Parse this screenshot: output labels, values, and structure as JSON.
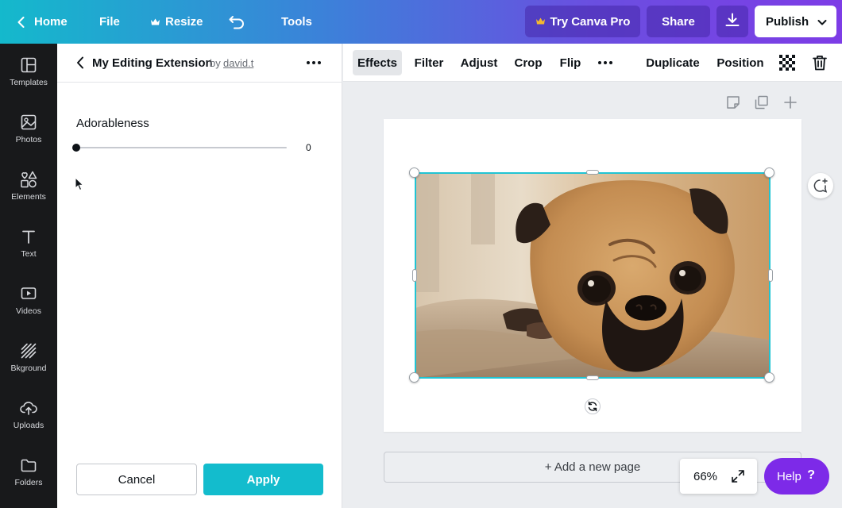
{
  "header": {
    "home_label": "Home",
    "file_label": "File",
    "resize_label": "Resize",
    "tools_label": "Tools",
    "try_pro_label": "Try Canva Pro",
    "share_label": "Share",
    "publish_label": "Publish"
  },
  "sidebar": {
    "items": [
      {
        "label": "Templates",
        "icon": "templates-icon"
      },
      {
        "label": "Photos",
        "icon": "photos-icon"
      },
      {
        "label": "Elements",
        "icon": "elements-icon"
      },
      {
        "label": "Text",
        "icon": "text-icon"
      },
      {
        "label": "Videos",
        "icon": "videos-icon"
      },
      {
        "label": "Bkground",
        "icon": "background-icon"
      },
      {
        "label": "Uploads",
        "icon": "uploads-icon"
      },
      {
        "label": "Folders",
        "icon": "folders-icon"
      }
    ]
  },
  "panel": {
    "title": "My Editing Extension",
    "by_label": "by",
    "author": "david.t",
    "slider": {
      "label": "Adorableness",
      "value": "0",
      "level": 0
    },
    "cancel_label": "Cancel",
    "apply_label": "Apply"
  },
  "toolbar": {
    "effects_label": "Effects",
    "filter_label": "Filter",
    "adjust_label": "Adjust",
    "crop_label": "Crop",
    "flip_label": "Flip",
    "duplicate_label": "Duplicate",
    "position_label": "Position"
  },
  "canvas": {
    "add_page_label": "+ Add a new page",
    "zoom_label": "66%",
    "help_label": "Help",
    "help_symbol": "?"
  },
  "colors": {
    "accent_teal": "#13bccd",
    "selection": "#20c4d3",
    "help_purple": "#7d2ae8",
    "pro_crown": "#f5b82e"
  }
}
